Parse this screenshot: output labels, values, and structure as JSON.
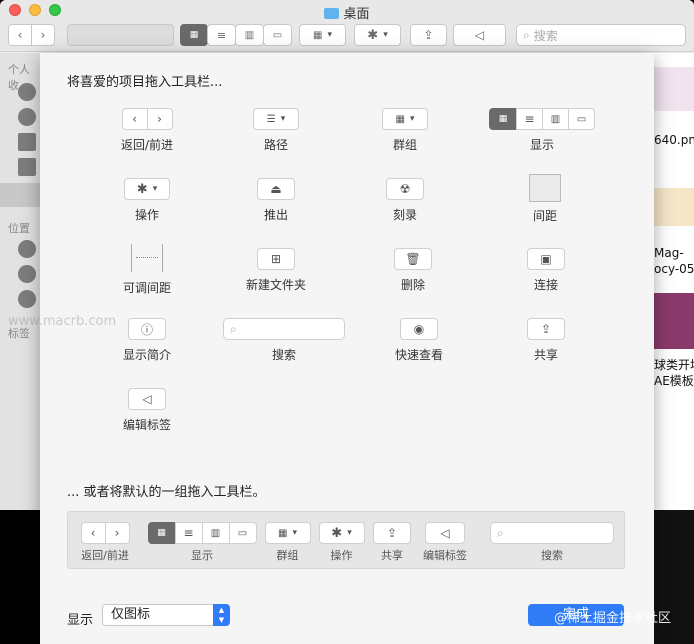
{
  "window": {
    "title": "桌面",
    "search_placeholder": "搜索"
  },
  "sidebar": {
    "section_personal": "个人收",
    "section_locations": "位置",
    "section_tags": "标签"
  },
  "files": [
    {
      "name": "640.pn"
    },
    {
      "name": "Mag-"
    },
    {
      "name": "ocy-05"
    },
    {
      "name": "球类开场"
    },
    {
      "name": "AE模板"
    }
  ],
  "sheet": {
    "heading": "将喜爱的项目拖入工具栏...",
    "items": {
      "back_forward": "返回/前进",
      "path": "路径",
      "group": "群组",
      "view": "显示",
      "action": "操作",
      "eject": "推出",
      "burn": "刻录",
      "space": "间距",
      "flexible_space": "可调间距",
      "new_folder": "新建文件夹",
      "delete": "删除",
      "connect": "连接",
      "get_info": "显示简介",
      "search": "搜索",
      "quick_look": "快速查看",
      "share": "共享",
      "edit_tags": "编辑标签"
    },
    "default_heading": "... 或者将默认的一组拖入工具栏。",
    "default_set": {
      "back_forward": "返回/前进",
      "view": "显示",
      "group": "群组",
      "action": "操作",
      "share": "共享",
      "edit_tags": "编辑标签",
      "search": "搜索"
    },
    "show_label": "显示",
    "show_option": "仅图标",
    "done_label": "完成"
  },
  "watermarks": {
    "left": "www.macrb.com",
    "right": "@稀土掘金技术社区"
  },
  "colors": {
    "accent": "#2f7cf6",
    "selected_segment": "#6a6a6a"
  }
}
